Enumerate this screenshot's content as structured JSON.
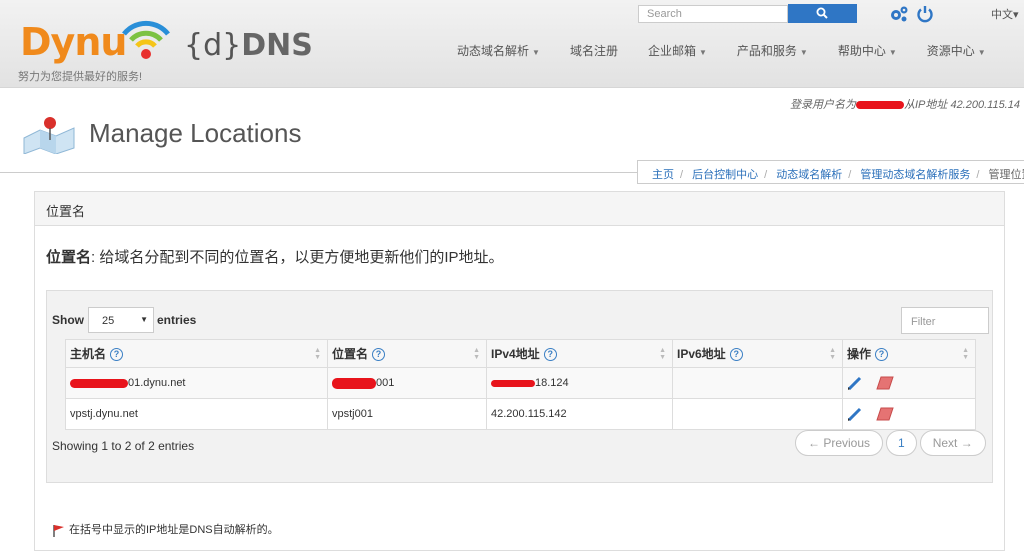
{
  "header": {
    "logo_text": "Dynu",
    "logo_ddns_brace": "{d}",
    "logo_ddns_text": "DNS",
    "tagline": "努力为您提供最好的服务!",
    "search_placeholder": "Search",
    "language": "中文",
    "nav": [
      {
        "label": "动态域名解析",
        "dropdown": true
      },
      {
        "label": "域名注册",
        "dropdown": false
      },
      {
        "label": "企业邮箱",
        "dropdown": true
      },
      {
        "label": "产品和服务",
        "dropdown": true
      },
      {
        "label": "帮助中心",
        "dropdown": true
      },
      {
        "label": "资源中心",
        "dropdown": true
      }
    ]
  },
  "user_line": {
    "prefix": "登录用户名为",
    "ip_text": "从IP地址 42.200.115.14"
  },
  "page": {
    "title": "Manage Locations",
    "breadcrumb": [
      "主页",
      "后台控制中心",
      "动态域名解析",
      "管理动态域名解析服务"
    ],
    "breadcrumb_current": "管理位置组"
  },
  "panel": {
    "heading": "位置名",
    "desc_bold": "位置名",
    "desc_text": ": 给域名分配到不同的位置名，以更方便地更新他们的IP地址。"
  },
  "table": {
    "show_label": "Show",
    "show_value": "25",
    "entries_label": "entries",
    "filter_placeholder": "Filter",
    "columns": [
      "主机名",
      "位置名",
      "IPv4地址",
      "IPv6地址",
      "操作"
    ],
    "rows": [
      {
        "host": "01.dynu.net",
        "location": "001",
        "ipv4": "18.124",
        "ipv6": ""
      },
      {
        "host": "vpstj.dynu.net",
        "location": "vpstj001",
        "ipv4": "42.200.115.142",
        "ipv6": ""
      }
    ],
    "info": "Showing 1 to 2 of 2 entries",
    "pager": {
      "prev": "← Previous",
      "page": "1",
      "next": "Next →"
    }
  },
  "footnote": "在括号中显示的IP地址是DNS自动解析的。",
  "colors": {
    "brand_orange": "#f08a1c",
    "link_blue": "#2a6fba",
    "search_blue": "#2f76c5",
    "redaction_red": "#e8141c"
  }
}
